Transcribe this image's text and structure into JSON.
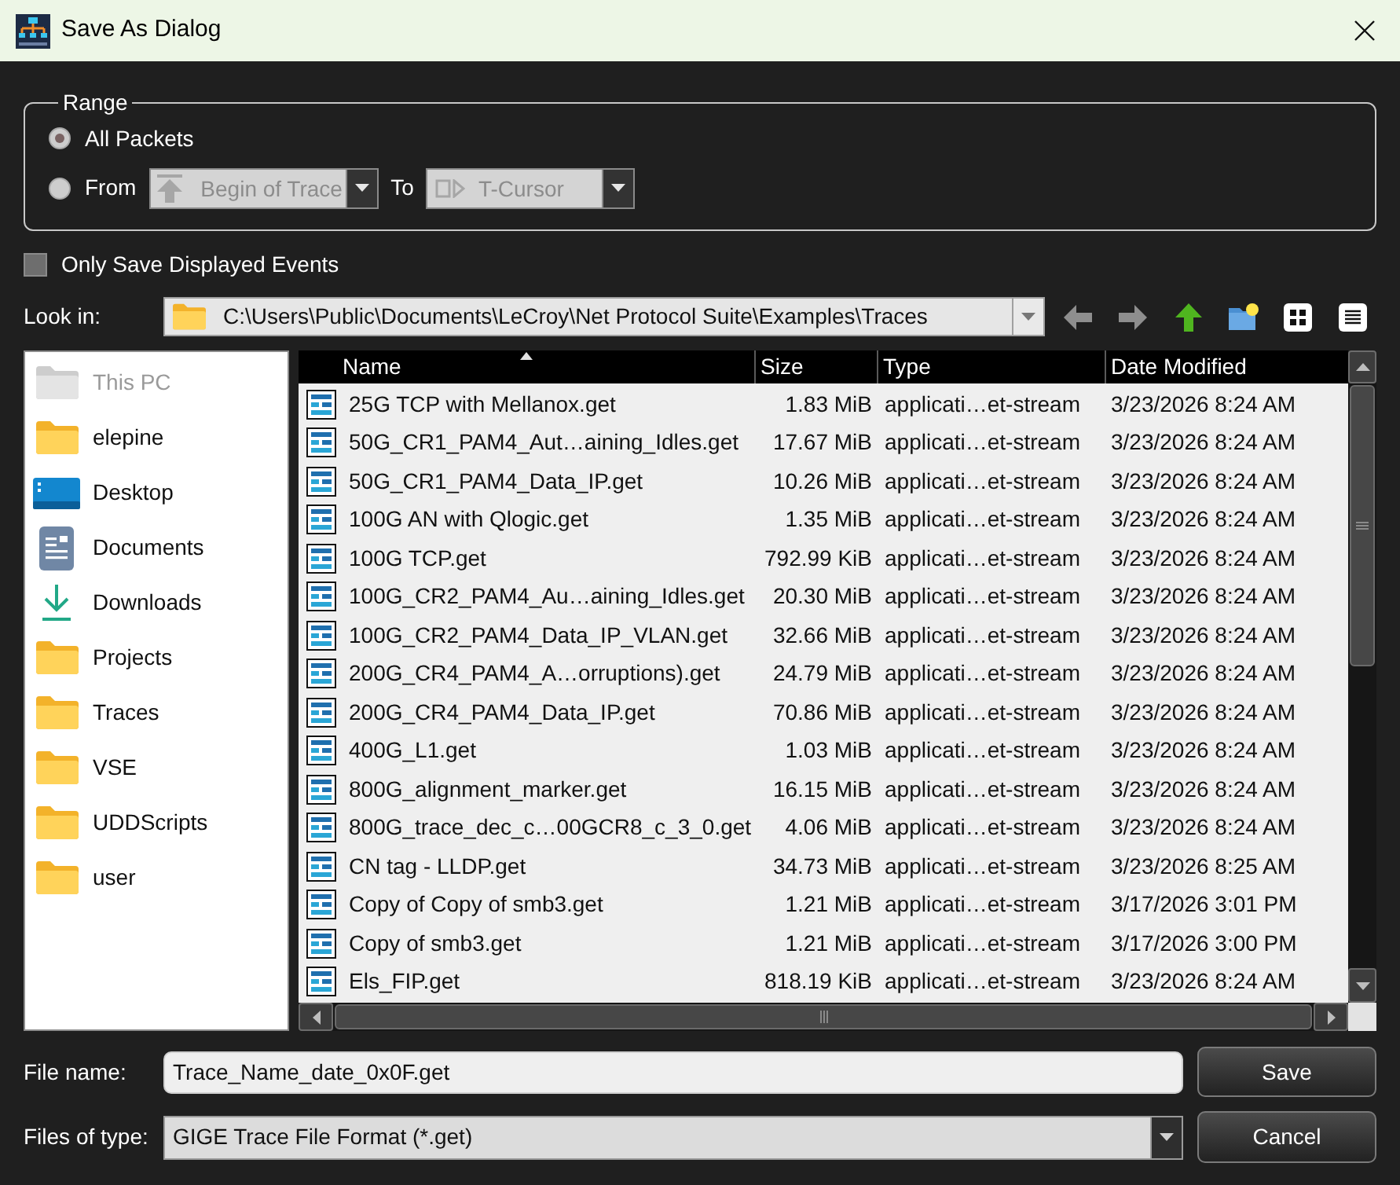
{
  "window": {
    "title": "Save As Dialog"
  },
  "range": {
    "title": "Range",
    "options": [
      {
        "label": "All Packets",
        "selected": true,
        "kind": "all"
      },
      {
        "label": "From",
        "selected": false,
        "kind": "span",
        "start": {
          "value": "Begin of Trace",
          "disabled": true
        },
        "separator": "To",
        "end": {
          "value": "T-Cursor",
          "disabled": true
        }
      }
    ]
  },
  "checkbox": {
    "label": "Only Save Displayed Events",
    "checked": false
  },
  "look_in": {
    "label": "Look in:",
    "path": "C:\\Users\\Public\\Documents\\LeCroy\\Net Protocol Suite\\Examples\\Traces"
  },
  "toolbar": [
    {
      "kind": "back",
      "disabled": true
    },
    {
      "kind": "forward",
      "disabled": true
    },
    {
      "kind": "up",
      "disabled": false
    },
    {
      "kind": "new_folder",
      "disabled": false
    },
    {
      "kind": "icon_view",
      "disabled": false
    },
    {
      "kind": "detail_view",
      "disabled": false
    }
  ],
  "sidebar": {
    "items": [
      {
        "label": "This PC",
        "kind": "computer",
        "disabled": true
      },
      {
        "label": "elepine",
        "kind": "folder",
        "disabled": false
      },
      {
        "label": "Desktop",
        "kind": "desktop",
        "disabled": false
      },
      {
        "label": "Documents",
        "kind": "documents",
        "disabled": false
      },
      {
        "label": "Downloads",
        "kind": "downloads",
        "disabled": false
      },
      {
        "label": "Projects",
        "kind": "folder",
        "disabled": false
      },
      {
        "label": "Traces",
        "kind": "folder",
        "disabled": false
      },
      {
        "label": "VSE",
        "kind": "folder",
        "disabled": false
      },
      {
        "label": "UDDScripts",
        "kind": "folder",
        "disabled": false
      },
      {
        "label": "user",
        "kind": "folder",
        "disabled": false
      }
    ]
  },
  "table": {
    "columns": [
      {
        "label": "Name",
        "sorted": true
      },
      {
        "label": "Size",
        "sorted": false
      },
      {
        "label": "Type",
        "sorted": false
      },
      {
        "label": "Date Modified",
        "sorted": false
      }
    ],
    "rows": [
      {
        "name": "25G TCP with Mellanox.get",
        "size": "1.83 MiB",
        "type": "applicati…et-stream",
        "date_modified": "3/23/2026 8:24 AM"
      },
      {
        "name": "50G_CR1_PAM4_Aut…aining_Idles.get",
        "size": "17.67 MiB",
        "type": "applicati…et-stream",
        "date_modified": "3/23/2026 8:24 AM"
      },
      {
        "name": "50G_CR1_PAM4_Data_IP.get",
        "size": "10.26 MiB",
        "type": "applicati…et-stream",
        "date_modified": "3/23/2026 8:24 AM"
      },
      {
        "name": "100G AN with Qlogic.get",
        "size": "1.35 MiB",
        "type": "applicati…et-stream",
        "date_modified": "3/23/2026 8:24 AM"
      },
      {
        "name": "100G TCP.get",
        "size": "792.99 KiB",
        "type": "applicati…et-stream",
        "date_modified": "3/23/2026 8:24 AM"
      },
      {
        "name": "100G_CR2_PAM4_Au…aining_Idles.get",
        "size": "20.30 MiB",
        "type": "applicati…et-stream",
        "date_modified": "3/23/2026 8:24 AM"
      },
      {
        "name": "100G_CR2_PAM4_Data_IP_VLAN.get",
        "size": "32.66 MiB",
        "type": "applicati…et-stream",
        "date_modified": "3/23/2026 8:24 AM"
      },
      {
        "name": "200G_CR4_PAM4_A…orruptions).get",
        "size": "24.79 MiB",
        "type": "applicati…et-stream",
        "date_modified": "3/23/2026 8:24 AM"
      },
      {
        "name": "200G_CR4_PAM4_Data_IP.get",
        "size": "70.86 MiB",
        "type": "applicati…et-stream",
        "date_modified": "3/23/2026 8:24 AM"
      },
      {
        "name": "400G_L1.get",
        "size": "1.03 MiB",
        "type": "applicati…et-stream",
        "date_modified": "3/23/2026 8:24 AM"
      },
      {
        "name": "800G_alignment_marker.get",
        "size": "16.15 MiB",
        "type": "applicati…et-stream",
        "date_modified": "3/23/2026 8:24 AM"
      },
      {
        "name": "800G_trace_dec_c…00GCR8_c_3_0.get",
        "size": "4.06 MiB",
        "type": "applicati…et-stream",
        "date_modified": "3/23/2026 8:24 AM"
      },
      {
        "name": "CN tag - LLDP.get",
        "size": "34.73 MiB",
        "type": "applicati…et-stream",
        "date_modified": "3/23/2026 8:25 AM"
      },
      {
        "name": "Copy of Copy of smb3.get",
        "size": "1.21 MiB",
        "type": "applicati…et-stream",
        "date_modified": "3/17/2026 3:01 PM"
      },
      {
        "name": "Copy of smb3.get",
        "size": "1.21 MiB",
        "type": "applicati…et-stream",
        "date_modified": "3/17/2026 3:00 PM"
      },
      {
        "name": "Els_FIP.get",
        "size": "818.19 KiB",
        "type": "applicati…et-stream",
        "date_modified": "3/23/2026 8:24 AM"
      }
    ]
  },
  "footer": {
    "rows": [
      {
        "label": "File name:",
        "kind": "input",
        "value": "Trace_Name_date_0x0F.get",
        "button": "Save"
      },
      {
        "label": "Files of type:",
        "kind": "dropdown",
        "value": "GIGE Trace File Format (*.get)",
        "button": "Cancel"
      }
    ]
  }
}
